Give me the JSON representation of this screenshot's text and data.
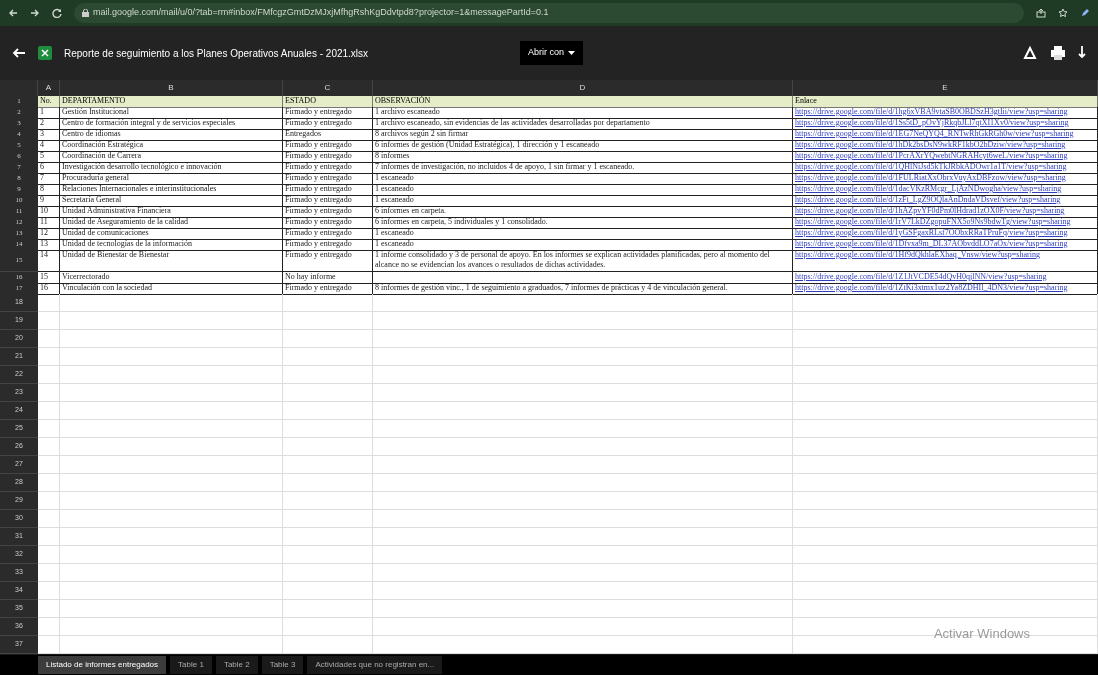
{
  "browser": {
    "url": "mail.google.com/mail/u/0/?tab=rm#inbox/FMfcgzGmtDzMJxjMfhgRshKgDdvtpd8?projector=1&messagePartId=0.1"
  },
  "viewer": {
    "file_name": "Reporte de seguimiento a los Planes Operativos Anuales - 2021.xlsx",
    "open_with": "Abrir con"
  },
  "sheet": {
    "columns": [
      "A",
      "B",
      "C",
      "D",
      "E"
    ],
    "header": {
      "number": "1",
      "cells": [
        "No.",
        "DEPARTAMENTO",
        "ESTADO",
        "OBSERVACIÓN",
        "Enlace"
      ]
    },
    "rows": [
      {
        "number": "2",
        "cells": [
          "1",
          "Gestión Institucional",
          "Firmado y entregado",
          "1 archivo escaneado",
          "https://drive.google.com/file/d/1hg6xVBA9vtaSB0OBDSzH3gtIii/view?usp=sharing"
        ],
        "tall": false
      },
      {
        "number": "3",
        "cells": [
          "2",
          "Centro de formación integral y de servicios especiales",
          "Firmado y entregado",
          "1 archivo escaneado, sin evidencias de las actividades desarrolladas por departamento",
          "https://drive.google.com/file/d/1Ss5tD_pOvYjRkqbJLl7qtXI1Xv0/view?usp=sharing"
        ],
        "tall": false
      },
      {
        "number": "4",
        "cells": [
          "3",
          "Centro de idiomas",
          "Entregados",
          "8 archivos según 2 sin firmar",
          "https://drive.google.com/file/d/1EG7NeQYQ4_RNTwRhGkRGh0w/view?usp=sharing"
        ],
        "tall": false
      },
      {
        "number": "5",
        "cells": [
          "4",
          "Coordinación Estratégica",
          "Firmado y entregado",
          "6 informes de gestión (Unidad Estratégica), 1 dirección y 1 escaneado",
          "https://drive.google.com/file/d/1hDk2bsDsN9wkRF1kbO2bDziw/view?usp=sharing"
        ],
        "tall": false
      },
      {
        "number": "6",
        "cells": [
          "5",
          "Coordinación de Carrera",
          "Firmado y entregado",
          "8 informes",
          "https://drive.google.com/file/d/1PcrAXrYQwebtNGRAHcyt6weL/view?usp=sharing"
        ],
        "tall": false
      },
      {
        "number": "7",
        "cells": [
          "6",
          "Investigación desarrollo tecnológico e innovación",
          "Firmado y entregado",
          "7 informes de investigación, no incluidos 4 de apoyo, 1 sin firmar y 1 escaneado.",
          "https://drive.google.com/file/d/1QHlNiJsd5kTkJRbkADOwr1a1T/view?usp=sharing"
        ],
        "tall": false
      },
      {
        "number": "8",
        "cells": [
          "7",
          "Procuraduría general",
          "Firmado y entregado",
          "1 escaneado",
          "https://drive.google.com/file/d/1FULRiatXxObrxVuyAxDBFzow/view?usp=sharing"
        ],
        "tall": false
      },
      {
        "number": "9",
        "cells": [
          "8",
          "Relaciones Internacionales e interinstitucionales",
          "Firmado y entregado",
          "1 escaneado",
          "https://drive.google.com/file/d/1dacVKzRMcgr_LjAzNDwogha/view?usp=sharing"
        ],
        "tall": false
      },
      {
        "number": "10",
        "cells": [
          "9",
          "Secretaría General",
          "Firmado y entregado",
          "1 escaneado",
          "https://drive.google.com/file/d/1zFt_LgZ9OQlaAnDndaVDsvef/view?usp=sharing"
        ],
        "tall": false
      },
      {
        "number": "11",
        "cells": [
          "10",
          "Unidad Administrativa Financiera",
          "Firmado y entregado",
          "6 informes en carpeta.",
          "https://drive.google.com/file/d/1hAZpvYF0dPm0lHdrad1zOX0F/view?usp=sharing"
        ],
        "tall": false
      },
      {
        "number": "12",
        "cells": [
          "11",
          "Unidad de Aseguramiento de la calidad",
          "Firmado y entregado",
          "6 informes en carpeta, 5 individuales y 1 consolidado.",
          "https://drive.google.com/file/d/1rV7LkDZgopuFNX5o9Ns9bdwTg/view?usp=sharing"
        ],
        "tall": false
      },
      {
        "number": "13",
        "cells": [
          "12",
          "Unidad de comunicaciones",
          "Firmado y entregado",
          "1 escaneado",
          "https://drive.google.com/file/d/1yGSFgaxRLsf7OObxRRaTPruFq/view?usp=sharing"
        ],
        "tall": false
      },
      {
        "number": "14",
        "cells": [
          "13",
          "Unidad de tecnologías de la información",
          "Firmado y entregado",
          "1 escaneado",
          "https://drive.google.com/file/d/1Dfvxa9m_DL37AObvddLO7aOx/view?usp=sharing"
        ],
        "tall": false
      },
      {
        "number": "15",
        "cells": [
          "14",
          "Unidad de Bienestar de Bienestar",
          "Firmado y entregado",
          "1 informe consolidado y 3 de personal de apoyo. En los informes se explican actividades planificadas, pero al momento del alcance no se evidencian los avances o resultados de dichas actividades.",
          "https://drive.google.com/file/d/1Hf9dQkhlaEXhaq_Vnsw/view?usp=sharing"
        ],
        "tall": true
      },
      {
        "number": "16",
        "cells": [
          "15",
          "Vicerrectorado",
          "No hay informe",
          "",
          "https://drive.google.com/file/d/1Z1JtVCDE54dQvH0qjlNN/view?usp=sharing"
        ],
        "tall": false
      },
      {
        "number": "17",
        "cells": [
          "16",
          "Vinculación con la sociedad",
          "Firmado y entregado",
          "8 informes de gestión vinc., 1 de seguimiento a graduados, 7 informes de prácticas y 4 de vinculación general.",
          "https://drive.google.com/file/d/1ZtKi3xtmx1uz2Ya8ZDHIl_4DN3/view?usp=sharing"
        ],
        "tall": false
      }
    ],
    "empty_row_numbers": [
      "18",
      "19",
      "20",
      "21",
      "22",
      "23",
      "24",
      "25",
      "26",
      "27",
      "28",
      "29",
      "30",
      "31",
      "32",
      "33",
      "34",
      "35",
      "36",
      "37"
    ]
  },
  "sheet_tabs": [
    {
      "label": "Listado de informes entregados",
      "selected": true
    },
    {
      "label": "Table 1",
      "selected": false
    },
    {
      "label": "Table 2",
      "selected": false
    },
    {
      "label": "Table 3",
      "selected": false
    },
    {
      "label": "Actividades que no registran en...",
      "selected": false
    }
  ],
  "os_notice": "Activar Windows"
}
